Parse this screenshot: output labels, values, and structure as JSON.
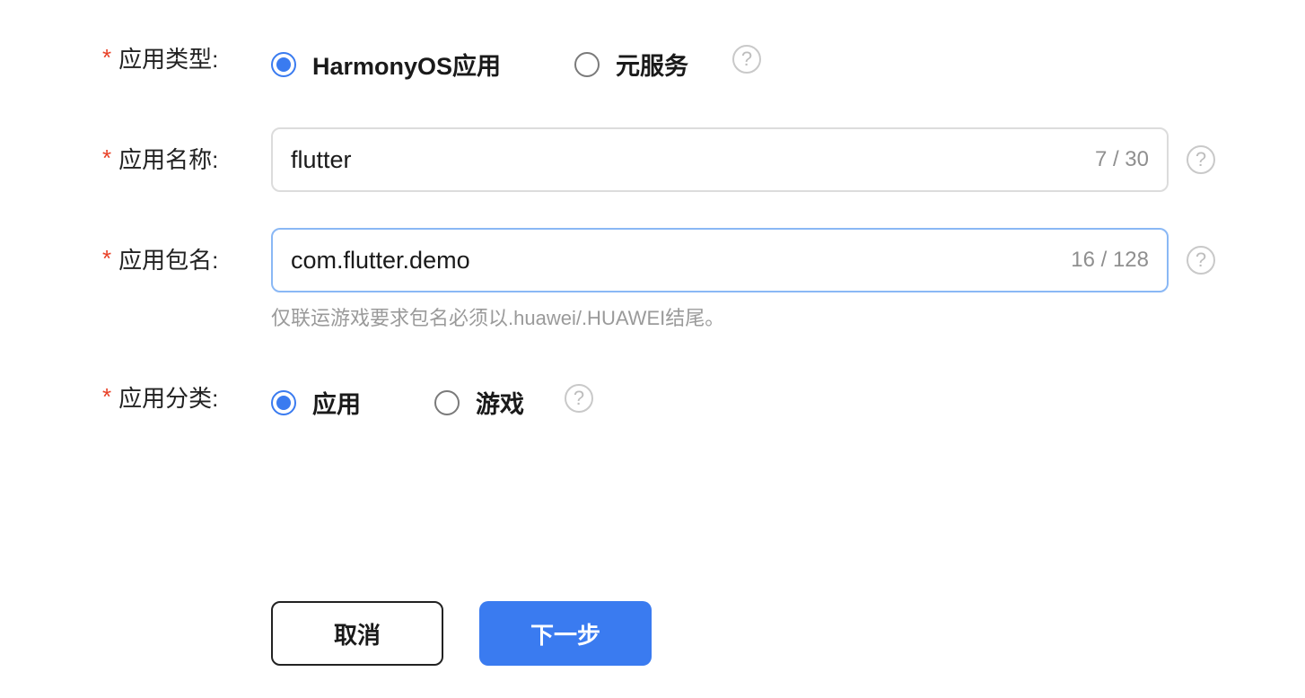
{
  "form": {
    "app_type": {
      "required_mark": "*",
      "label": "应用类型:",
      "options": [
        {
          "label": "HarmonyOS应用",
          "checked": true
        },
        {
          "label": "元服务",
          "checked": false
        }
      ],
      "help_icon": "question-circle-icon",
      "help_glyph": "?"
    },
    "app_name": {
      "required_mark": "*",
      "label": "应用名称:",
      "value": "flutter",
      "count": "7 / 30",
      "help_icon": "question-circle-icon",
      "help_glyph": "?"
    },
    "package_name": {
      "required_mark": "*",
      "label": "应用包名:",
      "value": "com.flutter.demo",
      "count": "16 / 128",
      "hint": "仅联运游戏要求包名必须以.huawei/.HUAWEI结尾。",
      "help_icon": "question-circle-icon",
      "help_glyph": "?"
    },
    "app_category": {
      "required_mark": "*",
      "label": "应用分类:",
      "options": [
        {
          "label": "应用",
          "checked": true
        },
        {
          "label": "游戏",
          "checked": false
        }
      ],
      "help_icon": "question-circle-icon",
      "help_glyph": "?"
    }
  },
  "actions": {
    "cancel_label": "取消",
    "next_label": "下一步"
  },
  "colors": {
    "primary": "#3a7bf0",
    "required": "#e84026",
    "focus_border": "#8ab8f5",
    "hint_text": "#9a9a9a"
  }
}
